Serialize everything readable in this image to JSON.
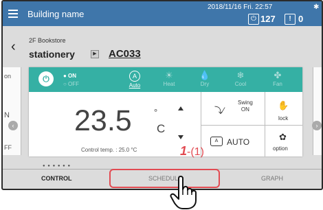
{
  "header": {
    "building_name": "Building name",
    "datetime": "2018/11/16 Fri. 22:57",
    "power_count": "127",
    "alert_count": "0",
    "icons": [
      "menu-icon",
      "power-icon",
      "alert-icon",
      "settings-icon"
    ]
  },
  "location": {
    "floor": "2F Bookstore",
    "group": "stationery",
    "unit": "AC033"
  },
  "side_left": {
    "top": "on",
    "mid": "N",
    "bottom": "FF"
  },
  "card": {
    "power_on": "● ON",
    "power_off": "○ OFF",
    "modes": [
      {
        "label": "Auto",
        "icon": "A"
      },
      {
        "label": "Heat",
        "icon": "☀"
      },
      {
        "label": "Dry",
        "icon": "💧"
      },
      {
        "label": "Cool",
        "icon": "❄"
      },
      {
        "label": "Fan",
        "icon": "✤"
      }
    ],
    "active_mode": "Auto",
    "setpoint": "23.5",
    "degree": "°",
    "unit": "C",
    "control_temp": "Control temp. : 25.0 °C",
    "swing_label": "Swing",
    "swing_value": "ON",
    "lock_label": "lock",
    "fan_speed": "AUTO",
    "option_label": "option"
  },
  "tabs": {
    "control": "CONTROL",
    "schedule": "SCHEDULE",
    "graph": "GRAPH"
  },
  "annotation": {
    "step": "1",
    "sub": "-(1)"
  },
  "colors": {
    "header": "#3f76aa",
    "card_accent": "#35b0a4",
    "highlight": "#e24b52"
  }
}
